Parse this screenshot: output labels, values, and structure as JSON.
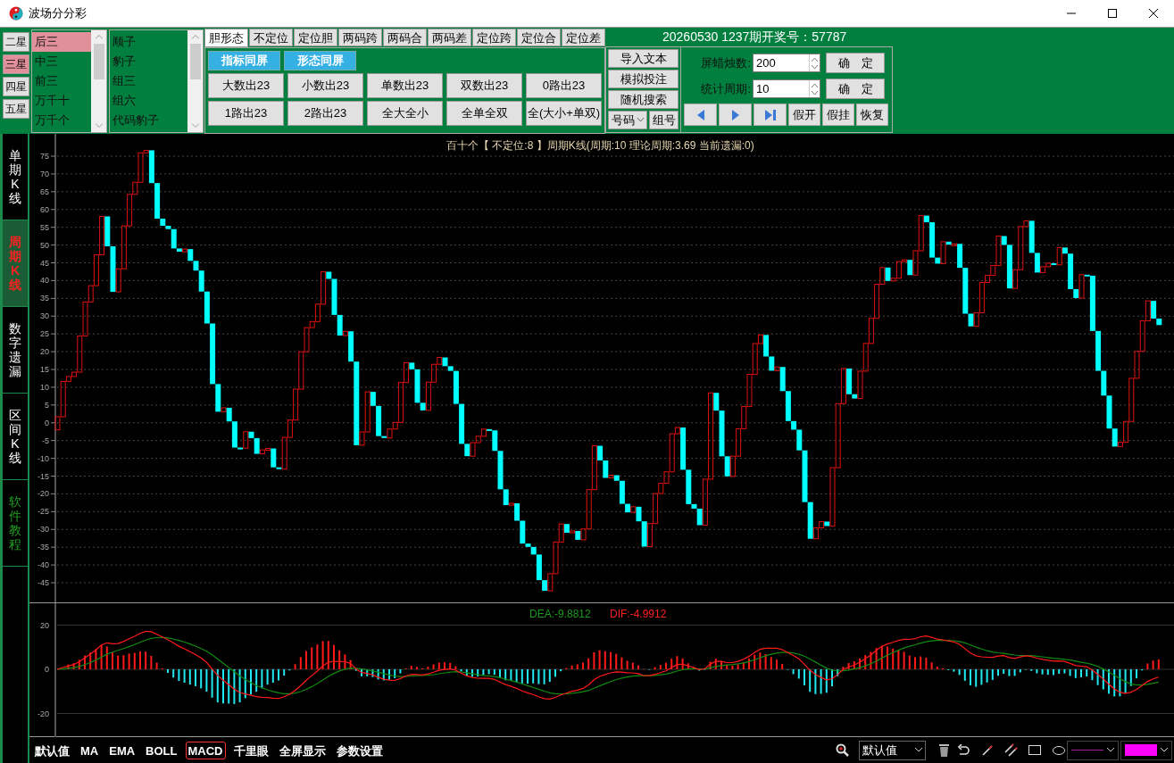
{
  "window": {
    "title": "波场分分彩"
  },
  "star_buttons": [
    {
      "label": "二星",
      "selected": false
    },
    {
      "label": "三星",
      "selected": true
    },
    {
      "label": "四星",
      "selected": false
    },
    {
      "label": "五星",
      "selected": false
    }
  ],
  "position_list": [
    {
      "label": "后三",
      "selected": true
    },
    {
      "label": "中三",
      "selected": false
    },
    {
      "label": "前三",
      "selected": false
    },
    {
      "label": "万千十",
      "selected": false
    },
    {
      "label": "万千个",
      "selected": false
    }
  ],
  "pattern_list": [
    {
      "label": "顺子",
      "selected": false
    },
    {
      "label": "豹子",
      "selected": false
    },
    {
      "label": "组三",
      "selected": false
    },
    {
      "label": "组六",
      "selected": false
    },
    {
      "label": "代码豹子",
      "selected": false
    }
  ],
  "tabs": [
    {
      "label": "胆形态",
      "selected": true
    },
    {
      "label": "不定位",
      "selected": false
    },
    {
      "label": "定位胆",
      "selected": false
    },
    {
      "label": "两码跨",
      "selected": false
    },
    {
      "label": "两码合",
      "selected": false
    },
    {
      "label": "两码差",
      "selected": false
    },
    {
      "label": "定位跨",
      "selected": false
    },
    {
      "label": "定位合",
      "selected": false
    },
    {
      "label": "定位差",
      "selected": false
    }
  ],
  "screen_toggles": [
    "指标同屏",
    "形态同屏"
  ],
  "pattern_buttons": [
    "大数出23",
    "小数出23",
    "单数出23",
    "双数出23",
    "0路出23",
    "1路出23",
    "2路出23",
    "全大全小",
    "全单全双",
    "全(大小+单双)"
  ],
  "draw_info": "20260530 1237期开奖号：57787",
  "action_buttons": [
    "导入文本",
    "模拟投注",
    "随机搜索"
  ],
  "number_dropdown": {
    "value": "号码"
  },
  "group_button": "组号",
  "settings": [
    {
      "label": "屏蜡烛数:",
      "value": "200",
      "button": "确　定"
    },
    {
      "label": "统计周期:",
      "value": "10",
      "button": "确　定"
    }
  ],
  "bet_buttons": [
    "假开",
    "假挂",
    "恢复"
  ],
  "side_tabs": [
    {
      "label": "单期K线",
      "selected": false,
      "kind": "tab"
    },
    {
      "label": "周期K线",
      "selected": true,
      "kind": "tab"
    },
    {
      "label": "数字遗漏",
      "selected": false,
      "kind": "tab"
    },
    {
      "label": "区间K线",
      "selected": false,
      "kind": "tab"
    },
    {
      "label": "软件教程",
      "selected": false,
      "kind": "tutorial"
    }
  ],
  "chart": {
    "title": "百十个【 不定位:8 】周期K线(周期:10 理论周期:3.69 当前遗漏:0)",
    "y_ticks": [
      "75",
      "70",
      "65",
      "60",
      "55",
      "50",
      "45",
      "40",
      "35",
      "30",
      "25",
      "20",
      "15",
      "10",
      "5",
      "0",
      "-5",
      "-10",
      "-15",
      "-20",
      "-25",
      "-30",
      "-35",
      "-40",
      "-45"
    ]
  },
  "macd": {
    "dea": "DEA:-9.8812",
    "dif": "DIF:-4.9912",
    "y_ticks": [
      "20",
      "0",
      "-20"
    ]
  },
  "indicators": [
    {
      "label": "默认值",
      "selected": false
    },
    {
      "label": "MA",
      "selected": false
    },
    {
      "label": "EMA",
      "selected": false
    },
    {
      "label": "BOLL",
      "selected": false
    },
    {
      "label": "MACD",
      "selected": true
    },
    {
      "label": "千里眼",
      "selected": false
    },
    {
      "label": "全屏显示",
      "selected": false
    },
    {
      "label": "参数设置",
      "selected": false
    }
  ],
  "toolbar": {
    "preset": "默认值"
  }
}
